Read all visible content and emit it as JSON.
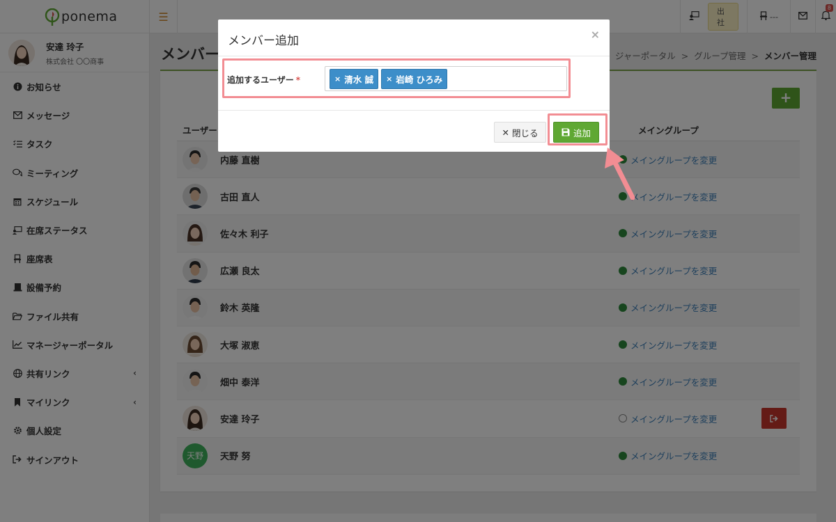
{
  "app": {
    "logo_text": "ponema"
  },
  "profile": {
    "name": "安達 玲子",
    "company": "株式会社 〇〇商事"
  },
  "sidebar": {
    "items": [
      {
        "label": "お知らせ",
        "icon": "info-icon"
      },
      {
        "label": "メッセージ",
        "icon": "envelope-icon"
      },
      {
        "label": "タスク",
        "icon": "task-list-icon"
      },
      {
        "label": "ミーティング",
        "icon": "chat-bubbles-icon"
      },
      {
        "label": "スケジュール",
        "icon": "calendar-icon"
      },
      {
        "label": "在席ステータス",
        "icon": "presence-icon"
      },
      {
        "label": "座席表",
        "icon": "seat-icon"
      },
      {
        "label": "設備予約",
        "icon": "equipment-icon"
      },
      {
        "label": "ファイル共有",
        "icon": "folder-icon"
      },
      {
        "label": "マネージャーポータル",
        "icon": "line-chart-icon"
      },
      {
        "label": "共有リンク",
        "icon": "globe-icon",
        "has_chevron": true
      },
      {
        "label": "マイリンク",
        "icon": "bookmark-icon",
        "has_chevron": true
      },
      {
        "label": "個人設定",
        "icon": "gear-icon"
      },
      {
        "label": "サインアウト",
        "icon": "sign-out-icon"
      }
    ]
  },
  "topbar": {
    "status_label": "出社",
    "seat_label": "---",
    "notification_count": "8"
  },
  "page": {
    "title": "メンバー",
    "breadcrumb": [
      "ジャーポータル",
      "グループ管理",
      "メンバー管理"
    ],
    "breadcrumb_sep": ">"
  },
  "table": {
    "col_user": "ユーザー",
    "col_main_group": "メイングループ",
    "change_link": "メイングループを変更",
    "rows": [
      {
        "name": "内藤 直樹",
        "main": true
      },
      {
        "name": "古田 直人",
        "main": true
      },
      {
        "name": "佐々木 利子",
        "main": true
      },
      {
        "name": "広瀬 良太",
        "main": true
      },
      {
        "name": "鈴木 英隆",
        "main": true
      },
      {
        "name": "大塚 淑恵",
        "main": true
      },
      {
        "name": "畑中 泰洋",
        "main": true
      },
      {
        "name": "安達 玲子",
        "main": false,
        "can_leave": true
      },
      {
        "name": "天野 努",
        "main": true,
        "initials": "天野"
      }
    ]
  },
  "modal": {
    "title": "メンバー追加",
    "close_symbol": "×",
    "field_label": "追加するユーザー",
    "required_mark": "*",
    "tags": [
      "清水 誠",
      "岩崎 ひろみ"
    ],
    "tag_remove_symbol": "×",
    "close_button": "閉じる",
    "add_button": "追加"
  },
  "colors": {
    "primary_green": "#5fa833",
    "tag_blue": "#3d8ec9",
    "link_blue": "#3c7fb8",
    "highlight_pink": "#f28d93",
    "danger_red": "#c9362d"
  }
}
